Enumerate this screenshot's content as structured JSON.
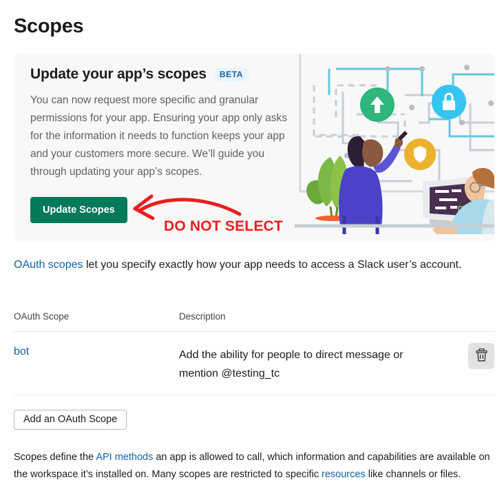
{
  "page": {
    "title": "Scopes"
  },
  "promo": {
    "heading": "Update your app’s scopes",
    "badge": "BETA",
    "body": "You can now request more specific and granular permissions for your app. Ensuring your app only asks for the information it needs to function keeps your app and your customers more secure. We’ll guide you through updating your app’s scopes.",
    "button_label": "Update Scopes",
    "button_color": "#007a5a",
    "badge_bg": "#e8f5fc",
    "badge_color": "#1264a3",
    "card_bg": "#f8f8f8",
    "illustration_name": "team-collaboration-flowchart-illustration"
  },
  "annotation": {
    "label": "DO NOT SELECT",
    "color": "#ea1e1e",
    "arrow_name": "red-curved-arrow-pointing-left"
  },
  "oauth_intro": {
    "link_text": "OAuth scopes",
    "rest": " let you specify exactly how your app needs to access a Slack user’s account."
  },
  "table": {
    "headers": {
      "scope": "OAuth Scope",
      "description": "Description"
    },
    "rows": [
      {
        "scope": "bot",
        "description": "Add the ability for people to direct message or mention @testing_tc",
        "delete_icon": "trash-icon"
      }
    ]
  },
  "actions": {
    "add_scope_label": "Add an OAuth Scope"
  },
  "footer": {
    "part1": "Scopes define the ",
    "link1": "API methods",
    "part2": " an app is allowed to call, which information and capabilities are available on the workspace it’s installed on. Many scopes are restricted to specific ",
    "link2": "resources",
    "part3": " like channels or files."
  },
  "colors": {
    "link": "#1264a3",
    "text": "#1d1c1d",
    "muted": "#616061"
  }
}
